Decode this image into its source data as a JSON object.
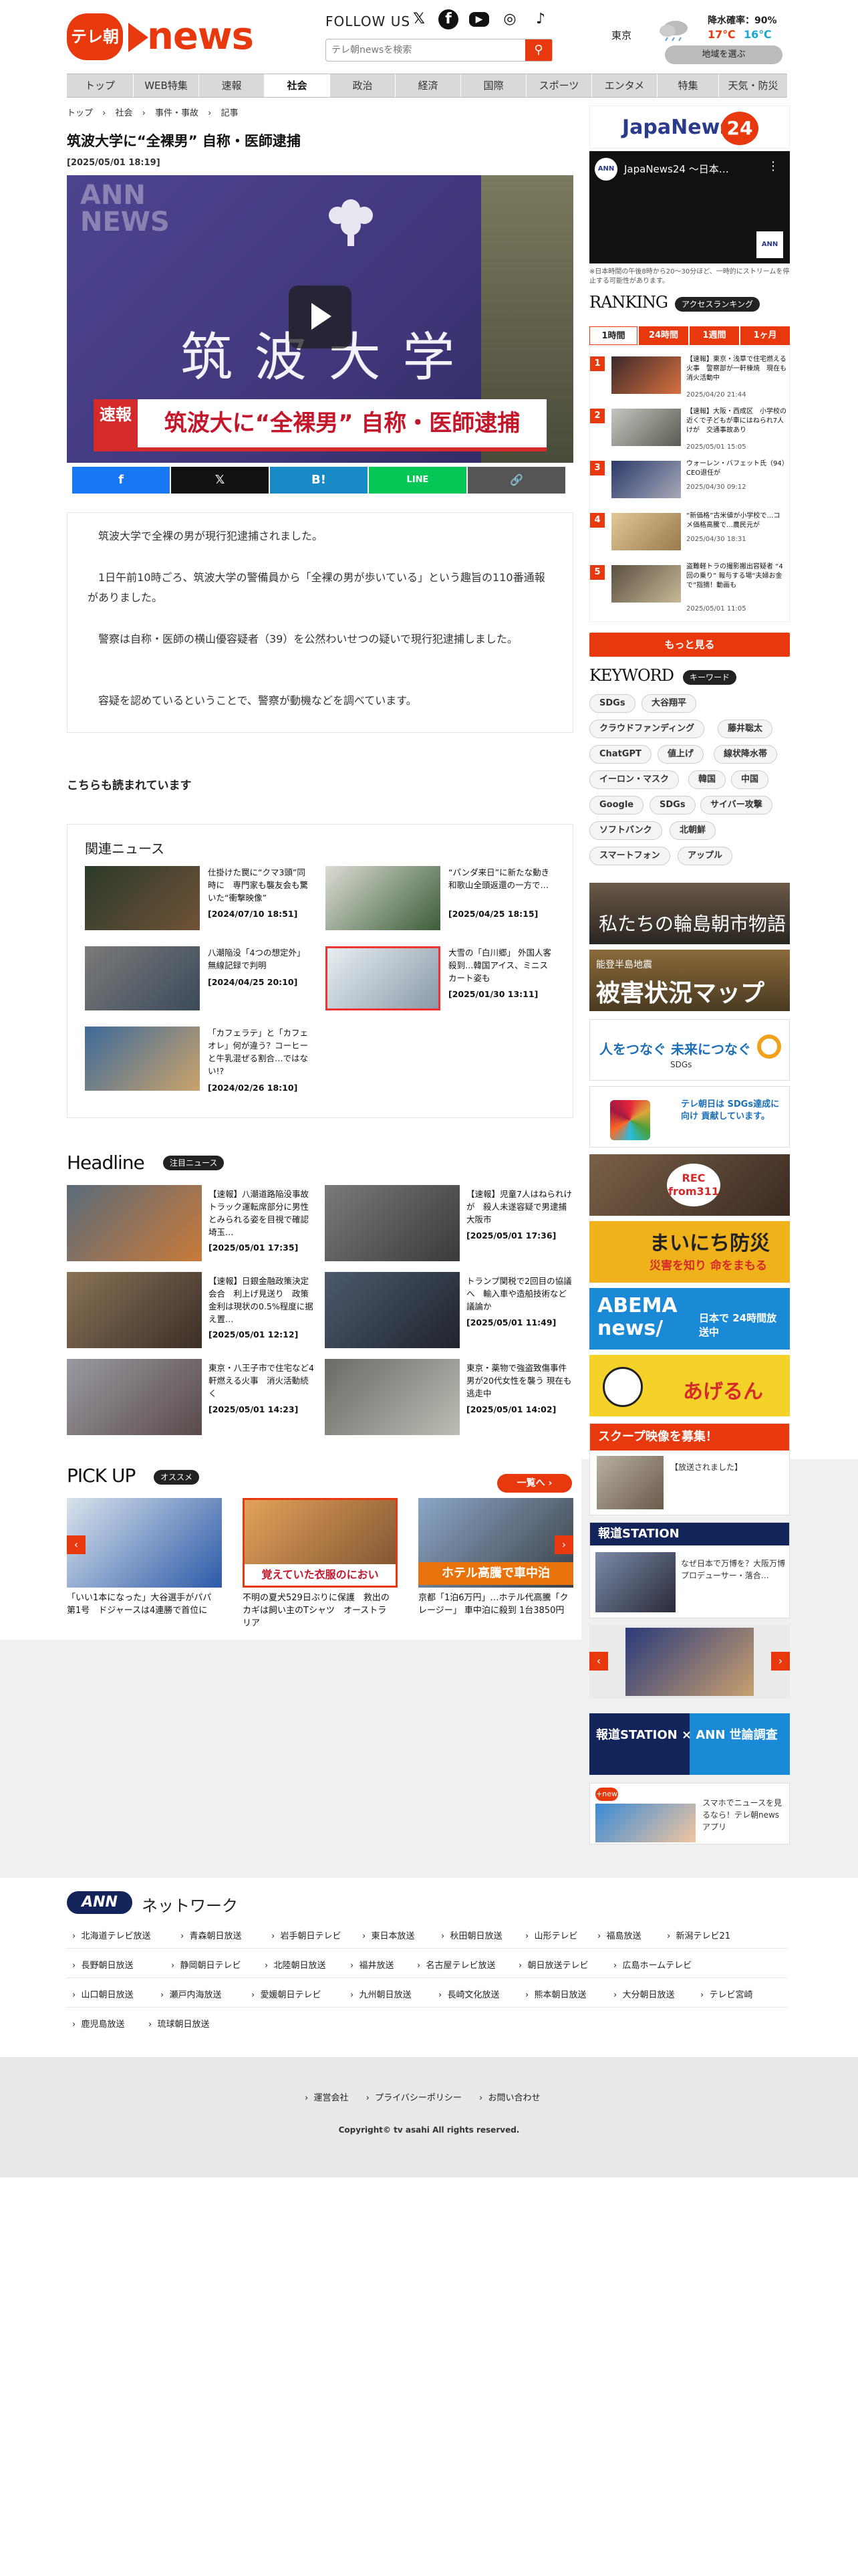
{
  "header": {
    "logo_text": "テレ朝",
    "logo_word": "news",
    "follow_us": "FOLLOW US",
    "sns": [
      {
        "icon": "x-icon",
        "glyph": "𝕏"
      },
      {
        "icon": "facebook-icon",
        "glyph": "f"
      },
      {
        "icon": "youtube-icon",
        "glyph": "▶"
      },
      {
        "icon": "instagram-icon",
        "glyph": "◎"
      },
      {
        "icon": "tiktok-icon",
        "glyph": "♪"
      }
    ],
    "search_placeholder": "テレ朝newsを検索",
    "weather": {
      "city": "東京",
      "rain": "降水確率：90%",
      "high": "17℃",
      "low": "16℃",
      "region_button": "地域を選ぶ"
    }
  },
  "nav": [
    "トップ",
    "WEB特集",
    "速報",
    "社会",
    "政治",
    "経済",
    "国際",
    "スポーツ",
    "エンタメ",
    "特集",
    "天気・防災"
  ],
  "breadcrumb": [
    "トップ",
    "社会",
    "事件・事故",
    "記事"
  ],
  "article": {
    "title": "筑波大学に“全裸男” 自称・医師逮捕",
    "date": "[2025/05/01 18:19]",
    "video_badge": "速報",
    "video_caption": "筑波大に“全裸男” 自称・医師逮捕",
    "video_sign": "筑 波 大 学",
    "video_watermark": "ANN NEWS",
    "share": [
      "f",
      "𝕏",
      "B!",
      "LINE",
      "🔗"
    ],
    "paragraphs": [
      "筑波大学で全裸の男が現行犯逮捕されました。",
      "1日午前10時ごろ、筑波大学の警備員から「全裸の男が歩いている」という趣旨の110番通報がありました。",
      "警察は自称・医師の横山優容疑者（39）を公然わいせつの疑いで現行犯逮捕しました。",
      "容疑を認めているということで、警察が動機などを調べています。"
    ]
  },
  "most_read": "こちらも読まれています",
  "related": {
    "title": "関連ニュース",
    "items": [
      {
        "text": "仕掛けた罠に“クマ3頭”同時に　専門家も襲友会も驚いた“衝撃映像”",
        "date": "[2024/07/10 18:51]"
      },
      {
        "text": "“パンダ来日”に新たな動き 和歌山全頭返還の一方で…",
        "date": "[2025/04/25 18:15]"
      },
      {
        "text": "八潮陥没「4つの想定外」 無線記録で判明",
        "date": "[2024/04/25 20:10]"
      },
      {
        "text": "大雪の「白川郷」 外国人客殺到…韓国アイス、ミニスカート姿も",
        "date": "[2025/01/30 13:11]"
      },
      {
        "text": "「カフェラテ」と「カフェオレ」何が違う？コーヒーと牛乳混ぜる割合…ではない!?",
        "date": "[2024/02/26 18:10]"
      }
    ]
  },
  "headline": {
    "title": "Headline",
    "pill": "注目ニュース",
    "items": [
      {
        "text": "【速報】八潮道路陥没事故 トラック運転席部分に男性とみられる姿を目視で確認 埼玉…",
        "date": "[2025/05/01 17:35]"
      },
      {
        "text": "【速報】児童7人はねられけが　殺人未遂容疑で男逮捕　大阪市",
        "date": "[2025/05/01 17:36]"
      },
      {
        "text": "【速報】日銀金融政策決定会合　利上げ見送り　政策金利は現状の0.5%程度に据え置…",
        "date": "[2025/05/01 12:12]"
      },
      {
        "text": "トランプ関税で2回目の協議へ　輸入車や造船技術など議論か",
        "date": "[2025/05/01 11:49]"
      },
      {
        "text": "東京・八王子市で住宅など4軒燃える火事　消火活動続く",
        "date": "[2025/05/01 14:23]"
      },
      {
        "text": "東京・薬物で強盗致傷事件　男が20代女性を襲う 現在も逃走中",
        "date": "[2025/05/01 14:02]"
      }
    ]
  },
  "pickup": {
    "title": "PICK UP",
    "pill": "オススメ",
    "more": "一覧へ ›",
    "items": [
      {
        "text": "「いい1本になった」大谷選手がパパ第1号　ドジャースは4連勝で首位に"
      },
      {
        "text": "不明の夏犬529日ぶりに保護　救出のカギは飼い主のTシャツ　オーストラリア",
        "overlay": "覚えていた衣服のにおい"
      },
      {
        "text": "京都「1泊6万円」…ホテル代高騰「クレージー」 車中泊に殺到 1台3850円",
        "overlay": "ホテル高騰で車中泊"
      }
    ]
  },
  "sidebar": {
    "japanews": "JapaNews",
    "japanews_num": "24",
    "live_title": "JapaNews24 ～日本…",
    "live_note": "※日本時間の午後8時から20～30分ほど、一時的にストリームを停止する可能性があります。",
    "ranking_title": "RANKING",
    "ranking_pill": "アクセスランキング",
    "ranking_tabs": [
      "1時間",
      "24時間",
      "1週間",
      "1ヶ月"
    ],
    "ranking": [
      {
        "n": "1",
        "text": "【速報】東京・浅草で住宅燃える火事　警察部が一軒棟焼　現在も消火活動中",
        "date": "2025/04/20 21:44"
      },
      {
        "n": "2",
        "text": "【速報】大阪・西成区　小学校の近くで子どもが車にはねられ7人けが　交通事故あり",
        "date": "2025/05/01 15:05"
      },
      {
        "n": "3",
        "text": "ウォーレン・バフェット氏（94）CEO退任が",
        "date": "2025/04/30 09:12"
      },
      {
        "n": "4",
        "text": "“新価格”古米値が小学校で…コメ価格高騰で…農民元が",
        "date": "2025/04/30 18:31"
      },
      {
        "n": "5",
        "text": "盗難軽トラの撮影搬出容疑者 “4回の乗り” 報与する場“夫婦お金で”指摘！動画も",
        "date": "2025/05/01 11:05"
      }
    ],
    "more": "もっと見る",
    "keyword_title": "KEYWORD",
    "keyword_pill": "キーワード",
    "keywords": [
      [
        "SDGs",
        "大谷翔平"
      ],
      [
        "クラウドファンディング",
        "藤井聡太"
      ],
      [
        "ChatGPT",
        "値上げ",
        "線状降水帯"
      ],
      [
        "イーロン・マスク",
        "韓国",
        "中国"
      ],
      [
        "Google",
        "SDGs",
        "サイバー攻撃"
      ],
      [
        "ソフトバンク",
        "北朝鮮"
      ],
      [
        "スマートフォン",
        "アップル"
      ]
    ],
    "banners": {
      "wajima": "私たちの輪島朝市物語",
      "map_sub": "能登半島地震",
      "map": "被害状況マップ",
      "sdgs": "人をつなぐ 未来につなぐ",
      "sdgs_sub": "SDGs",
      "sdgs2": "テレ朝日は SDGs達成に向け 貢献しています。",
      "rec": "REC from311",
      "bousai": "まいにち防災",
      "bousai_sub": "災害を知り 命をまもる",
      "abema": "ABEMA news/",
      "abema_sub": "日本で 24時間放送中",
      "ageru": "あげるん",
      "scoop": "スクープ映像を募集！",
      "scoop_sub": "【放送されました】",
      "hodo": "報道STATION",
      "hodo_text": "なぜ日本で万博を？大阪万博プロデューサー・落合…",
      "poll": "報道STATION × ANN 世論調査",
      "app_text": "スマホでニュースを見るなら！テレ朝newsアプリ",
      "new_label": "+new"
    }
  },
  "network": {
    "ann": "ANN",
    "title": "ネットワーク",
    "rows": [
      [
        "北海道テレビ放送",
        "青森朝日放送",
        "岩手朝日テレビ",
        "東日本放送",
        "秋田朝日放送",
        "山形テレビ",
        "福島放送",
        "新潟テレビ21"
      ],
      [
        "長野朝日放送",
        "静岡朝日テレビ",
        "北陸朝日放送",
        "福井放送",
        "名古屋テレビ放送",
        "朝日放送テレビ",
        "広島ホームテレビ"
      ],
      [
        "山口朝日放送",
        "瀬戸内海放送",
        "愛媛朝日テレビ",
        "九州朝日放送",
        "長崎文化放送",
        "熊本朝日放送",
        "大分朝日放送",
        "テレビ宮崎"
      ],
      [
        "鹿児島放送",
        "琉球朝日放送"
      ]
    ]
  },
  "footer": {
    "links": [
      "運営会社",
      "プライバシーポリシー",
      "お問い合わせ"
    ],
    "copyright": "Copyright© tv asahi All rights reserved."
  }
}
